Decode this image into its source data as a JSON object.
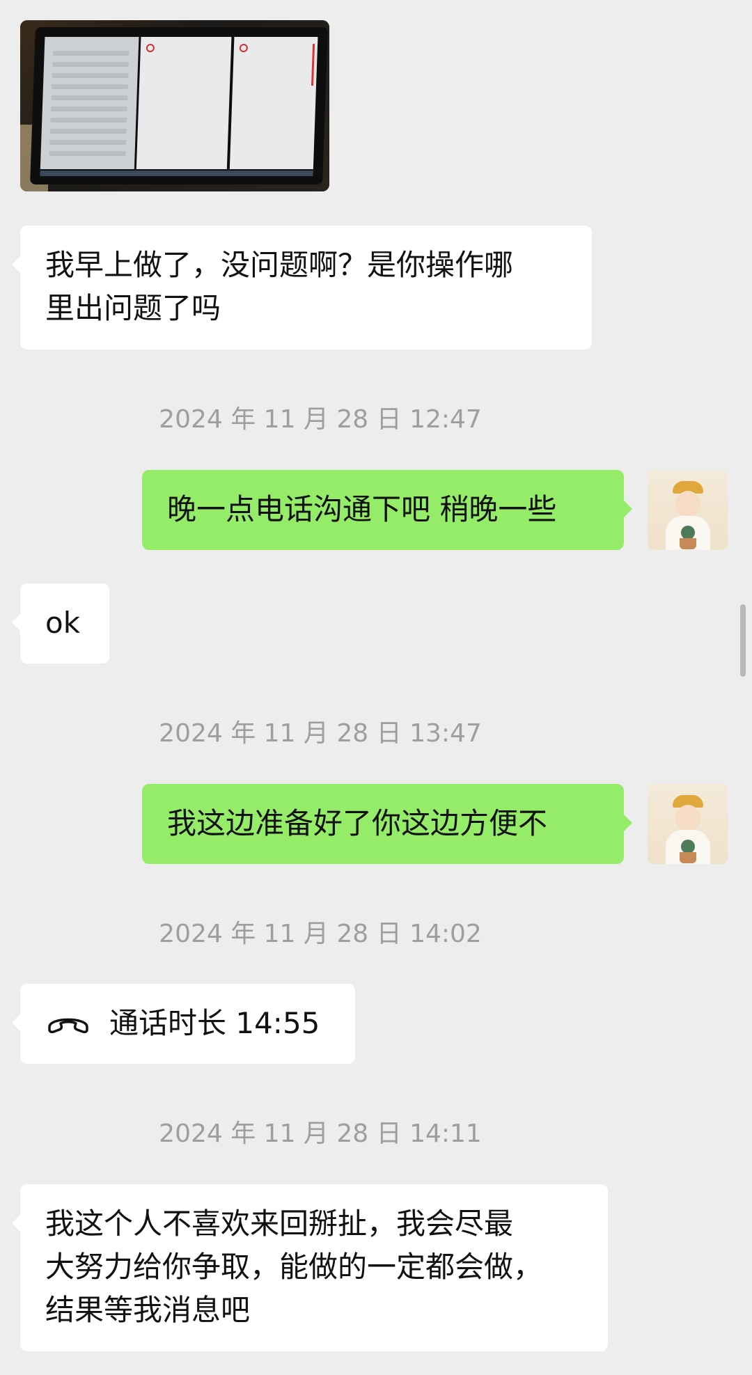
{
  "messages": {
    "image_message": {
      "icon": "photo-thumbnail"
    },
    "m1": {
      "lines": [
        "我早上做了，没问题啊？是你操作哪",
        "里出问题了吗"
      ]
    },
    "t1": "2024 年 11 月 28 日 12:47",
    "m2": "晚一点电话沟通下吧 稍晚一些",
    "m3": "ok",
    "t2": "2024 年 11 月 28 日 13:47",
    "m4": "我这边准备好了你这边方便不",
    "t3": "2024 年 11 月 28 日 14:02",
    "call": {
      "label": "通话时长 14:55",
      "icon": "phone-handset-icon"
    },
    "t4": "2024 年 11 月 28 日 14:11",
    "m5": {
      "lines": [
        "我这个人不喜欢来回掰扯，我会尽最",
        "大努力给你争取，能做的一定都会做，",
        "结果等我消息吧"
      ]
    }
  },
  "colors": {
    "background": "#ededed",
    "incoming_bubble": "#ffffff",
    "outgoing_bubble": "#95ec69",
    "timestamp": "#9e9e9e"
  }
}
